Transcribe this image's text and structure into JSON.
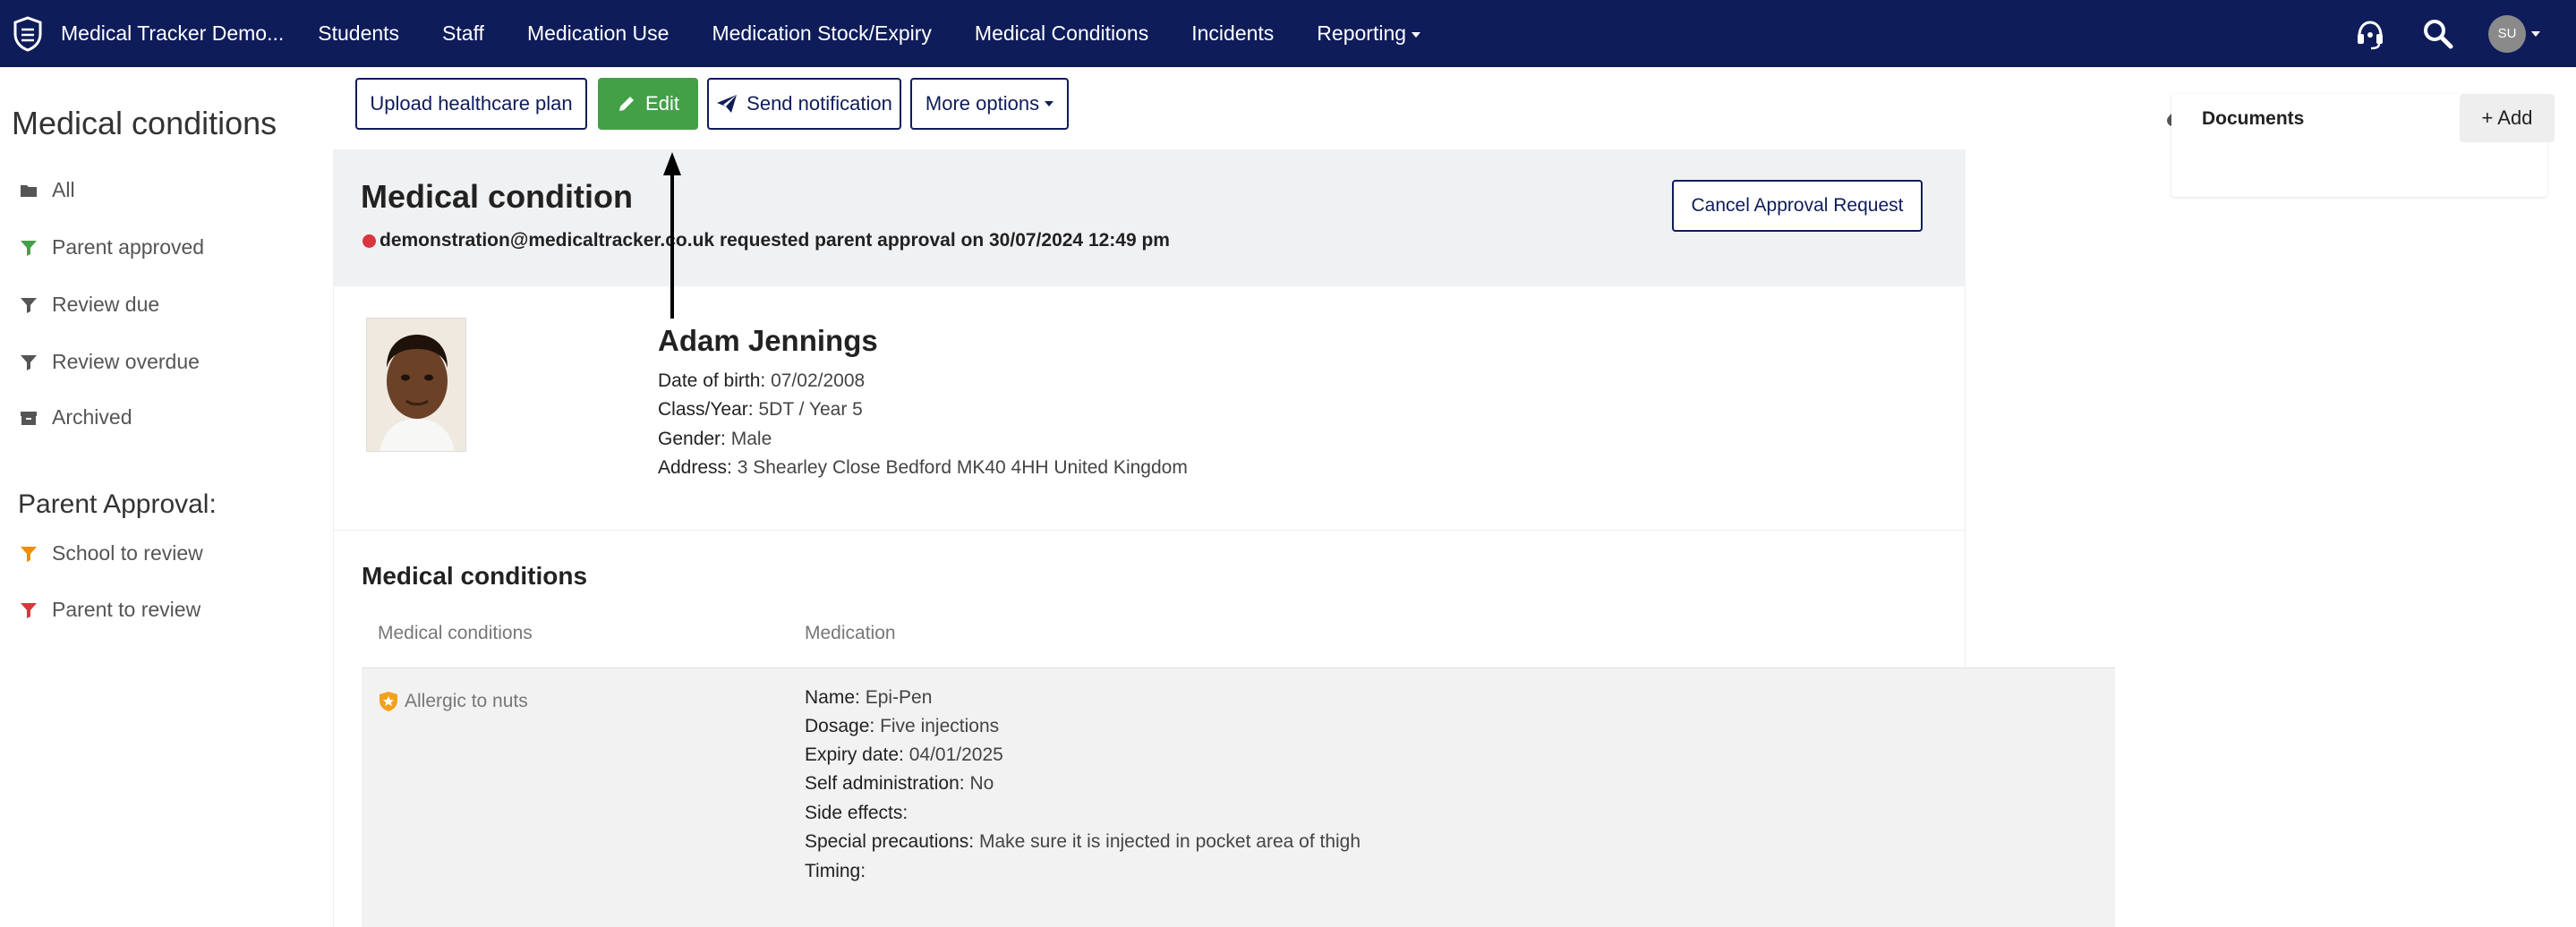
{
  "nav": {
    "brand": "Medical Tracker Demo...",
    "links": [
      "Students",
      "Staff",
      "Medication Use",
      "Medication Stock/Expiry",
      "Medical Conditions",
      "Incidents",
      "Reporting"
    ],
    "avatar_initials": "SU"
  },
  "sidebar": {
    "title": "Medical conditions",
    "items": [
      {
        "label": "All",
        "icon": "folder-icon",
        "color": "#555555"
      },
      {
        "label": "Parent approved",
        "icon": "filter-icon",
        "color": "#43a047"
      },
      {
        "label": "Review due",
        "icon": "filter-icon",
        "color": "#555555"
      },
      {
        "label": "Review overdue",
        "icon": "filter-icon",
        "color": "#555555"
      },
      {
        "label": "Archived",
        "icon": "archive-icon",
        "color": "#555555"
      }
    ],
    "approval_title": "Parent Approval:",
    "approval_items": [
      {
        "label": "School to review",
        "icon": "filter-icon",
        "color": "#f08c00"
      },
      {
        "label": "Parent to review",
        "icon": "filter-icon",
        "color": "#d9363e"
      }
    ]
  },
  "toolbar": {
    "upload": "Upload healthcare plan",
    "edit": "Edit",
    "send": "Send notification",
    "more": "More options"
  },
  "card": {
    "title": "Medical condition",
    "approval_text": "demonstration@medicaltracker.co.uk requested parent approval on 30/07/2024 12:49 pm",
    "cancel_btn": "Cancel Approval Request"
  },
  "student": {
    "name": "Adam Jennings",
    "dob_label": "Date of birth:",
    "dob": "07/02/2008",
    "class_label": "Class/Year:",
    "class": "5DT / Year 5",
    "gender_label": "Gender:",
    "gender": "Male",
    "address_label": "Address:",
    "address": "3 Shearley Close Bedford MK40 4HH United Kingdom"
  },
  "conditions": {
    "title": "Medical conditions",
    "col_conditions": "Medical conditions",
    "col_medication": "Medication",
    "condition": "Allergic to nuts",
    "medication": [
      {
        "label": "Name:",
        "value": "Epi-Pen"
      },
      {
        "label": "Dosage:",
        "value": "Five injections"
      },
      {
        "label": "Expiry date:",
        "value": "04/01/2025"
      },
      {
        "label": "Self administration:",
        "value": "No"
      },
      {
        "label": "Side effects:",
        "value": ""
      },
      {
        "label": "Special precautions:",
        "value": "Make sure it is injected in pocket area of thigh"
      },
      {
        "label": "Timing:",
        "value": ""
      }
    ]
  },
  "documents": {
    "title": "Documents",
    "add": "+ Add"
  }
}
